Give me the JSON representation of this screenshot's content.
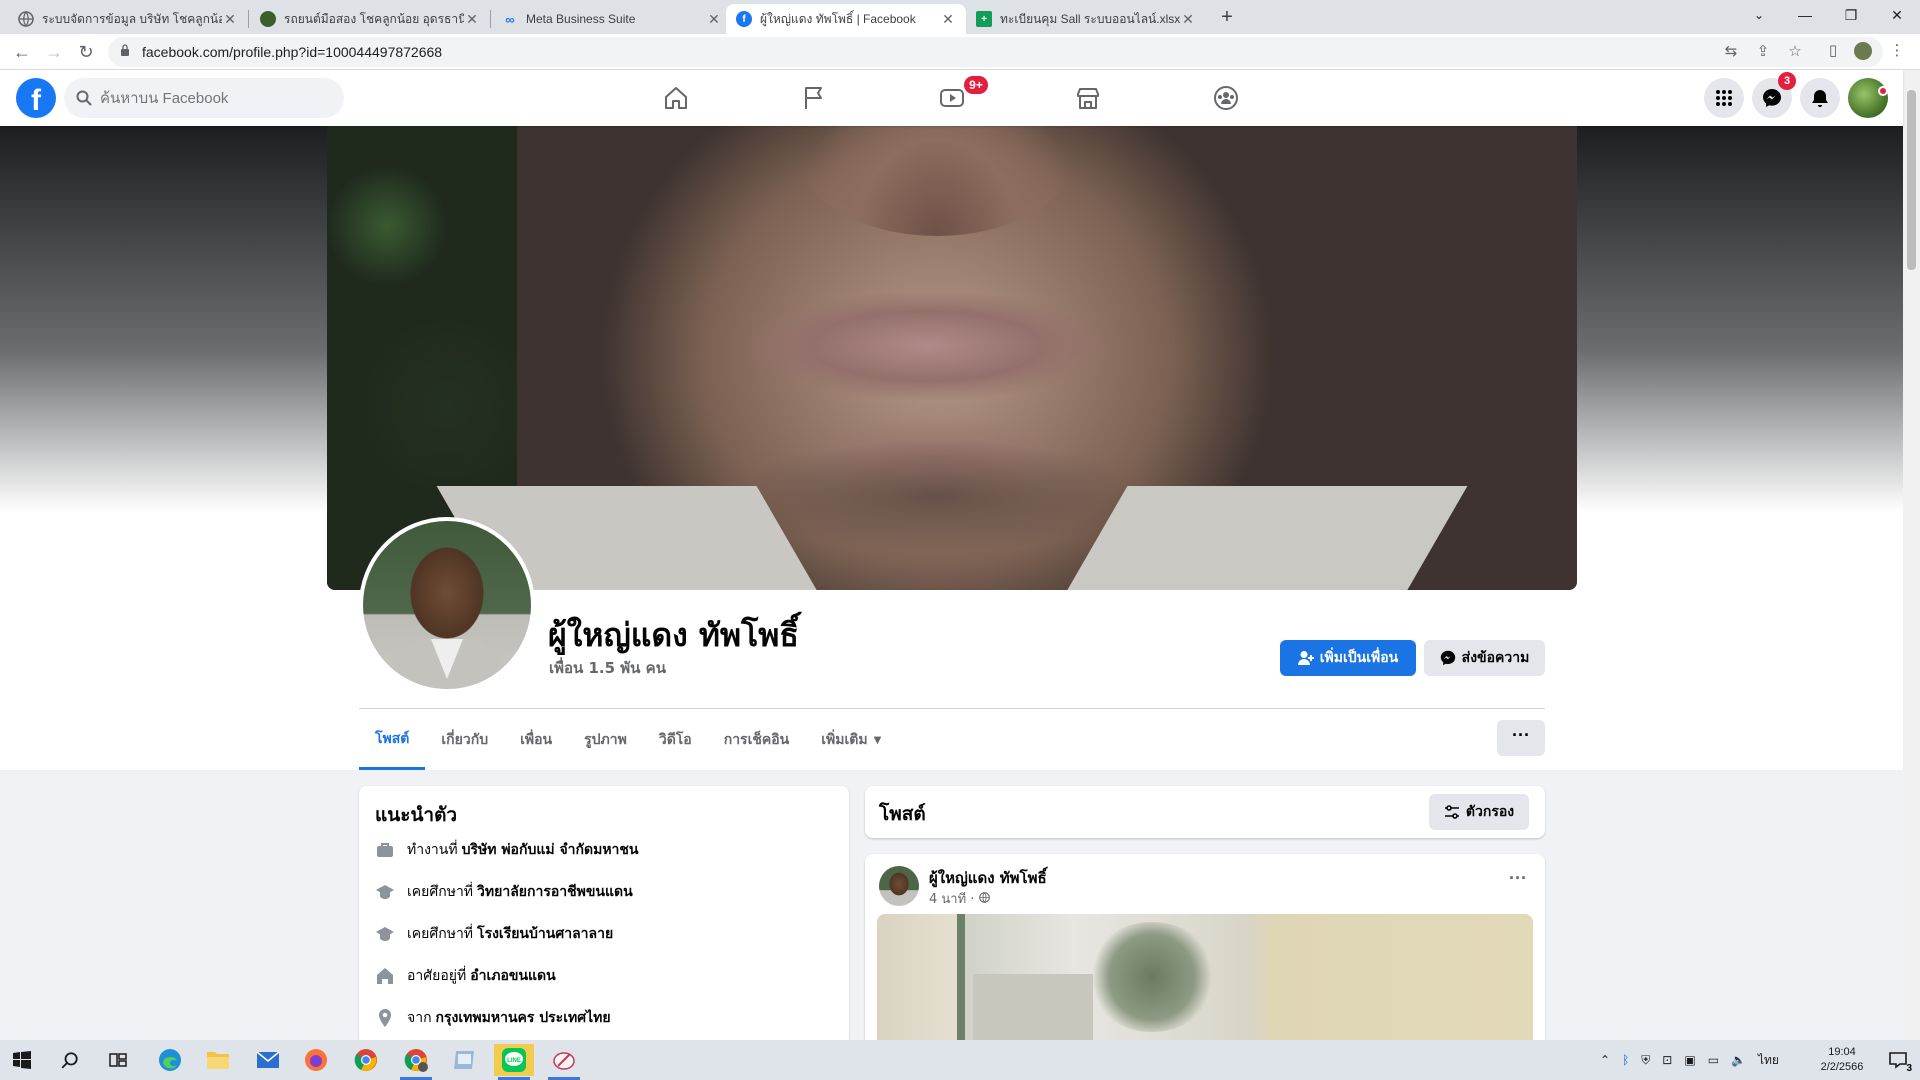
{
  "browser": {
    "tabs": [
      {
        "title": "ระบบจัดการข้อมูล บริษัท โชคลูกน้อย -",
        "favicon": "globe-icon",
        "active": false
      },
      {
        "title": "รถยนต์มือสอง โชคลูกน้อย อุดรธานี",
        "favicon": "page-icon",
        "active": false
      },
      {
        "title": "Meta Business Suite",
        "favicon": "meta-icon",
        "active": false
      },
      {
        "title": "ผู้ใหญ่แดง ทัพโพธิ์ | Facebook",
        "favicon": "facebook-icon",
        "active": true
      },
      {
        "title": "ทะเบียนคุม Sall ระบบออนไลน์.xlsx - G",
        "favicon": "sheets-icon",
        "active": false
      }
    ],
    "url": "facebook.com/profile.php?id=100044497872668"
  },
  "fb": {
    "search_placeholder": "ค้นหาบน Facebook",
    "watch_badge": "9+",
    "messenger_badge": "3",
    "brand_color": "#1877f2"
  },
  "profile": {
    "name": "ผู้ใหญ่แดง ทัพโพธิ์",
    "friends": "เพื่อน 1.5 พัน คน",
    "add_friend": "เพิ่มเป็นเพื่อน",
    "message": "ส่งข้อความ",
    "tabs": [
      "โพสต์",
      "เกี่ยวกับ",
      "เพื่อน",
      "รูปภาพ",
      "วิดีโอ",
      "การเช็คอิน",
      "เพิ่มเติม"
    ],
    "more_dots": "···"
  },
  "intro": {
    "title": "แนะนำตัว",
    "rows": [
      {
        "icon": "briefcase-icon",
        "prefix": "ทำงานที่",
        "value": "บริษัท พ่อกับแม่ จำกัดมหาชน"
      },
      {
        "icon": "graduation-cap-icon",
        "prefix": "เคยศึกษาที่",
        "value": "วิทยาลัยการอาชีพขนแดน"
      },
      {
        "icon": "graduation-cap-icon",
        "prefix": "เคยศึกษาที่",
        "value": "โรงเรียนบ้านศาลาลาย"
      },
      {
        "icon": "home-icon",
        "prefix": "อาศัยอยู่ที่",
        "value": "อำเภอขนแดน"
      },
      {
        "icon": "location-pin-icon",
        "prefix": "จาก",
        "value": "กรุงเทพมหานคร ประเทศไทย"
      }
    ]
  },
  "posts": {
    "title": "โพสต์",
    "filter": "ตัวกรอง",
    "items": [
      {
        "author": "ผู้ใหญ่แดง ทัพโพธิ์",
        "time": "4 นาที ·",
        "audience_icon": "globe-icon"
      }
    ]
  },
  "taskbar": {
    "lang": "ไทย",
    "time": "19:04",
    "date": "2/2/2566",
    "notifications": "3"
  }
}
